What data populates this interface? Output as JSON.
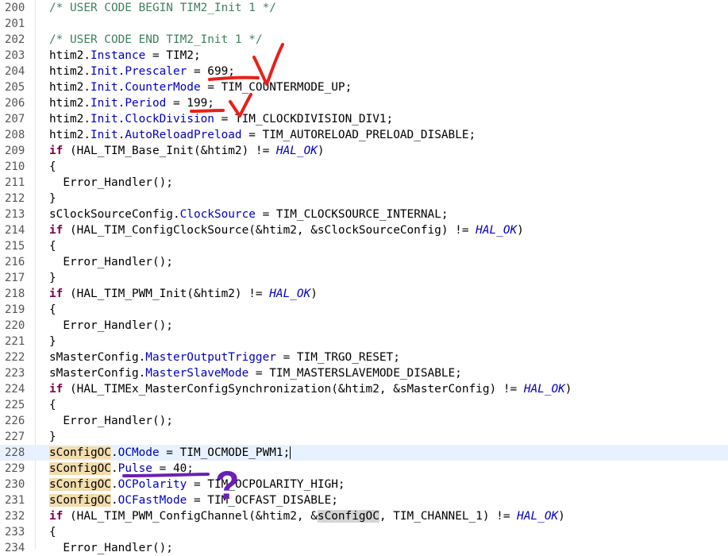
{
  "editor": {
    "lines": [
      {
        "n": "200",
        "seg": [
          [
            "/* USER CODE BEGIN TIM2_Init 1 */",
            "cm"
          ]
        ]
      },
      {
        "n": "201",
        "seg": []
      },
      {
        "n": "202",
        "seg": [
          [
            "/* USER CODE END TIM2_Init 1 */",
            "cm"
          ]
        ]
      },
      {
        "n": "203",
        "seg": [
          [
            "htim2.",
            ""
          ],
          [
            "Instance",
            "fld"
          ],
          [
            " = TIM2;",
            ""
          ]
        ]
      },
      {
        "n": "204",
        "seg": [
          [
            "htim2.",
            ""
          ],
          [
            "Init",
            "fld"
          ],
          [
            ".",
            ""
          ],
          [
            "Prescaler",
            "fld"
          ],
          [
            " = 699;",
            ""
          ]
        ]
      },
      {
        "n": "205",
        "seg": [
          [
            "htim2.",
            ""
          ],
          [
            "Init",
            "fld"
          ],
          [
            ".",
            ""
          ],
          [
            "CounterMode",
            "fld"
          ],
          [
            " = TIM_COUNTERMODE_UP;",
            ""
          ]
        ]
      },
      {
        "n": "206",
        "seg": [
          [
            "htim2.",
            ""
          ],
          [
            "Init",
            "fld"
          ],
          [
            ".",
            ""
          ],
          [
            "Period",
            "fld"
          ],
          [
            " = 199;",
            ""
          ]
        ]
      },
      {
        "n": "207",
        "seg": [
          [
            "htim2.",
            ""
          ],
          [
            "Init",
            "fld"
          ],
          [
            ".",
            ""
          ],
          [
            "ClockDivision",
            "fld"
          ],
          [
            " = TIM_CLOCKDIVISION_DIV1;",
            ""
          ]
        ]
      },
      {
        "n": "208",
        "seg": [
          [
            "htim2.",
            ""
          ],
          [
            "Init",
            "fld"
          ],
          [
            ".",
            ""
          ],
          [
            "AutoReloadPreload",
            "fld"
          ],
          [
            " = TIM_AUTORELOAD_PRELOAD_DISABLE;",
            ""
          ]
        ]
      },
      {
        "n": "209",
        "seg": [
          [
            "if",
            "kw"
          ],
          [
            " (HAL_TIM_Base_Init(&htim2) != ",
            ""
          ],
          [
            "HAL_OK",
            "hl"
          ],
          [
            ")",
            ""
          ]
        ]
      },
      {
        "n": "210",
        "seg": [
          [
            "{",
            ""
          ]
        ]
      },
      {
        "n": "211",
        "seg": [
          [
            "  Error_Handler();",
            ""
          ]
        ]
      },
      {
        "n": "212",
        "seg": [
          [
            "}",
            ""
          ]
        ]
      },
      {
        "n": "213",
        "seg": [
          [
            "sClockSourceConfig.",
            ""
          ],
          [
            "ClockSource",
            "fld"
          ],
          [
            " = TIM_CLOCKSOURCE_INTERNAL;",
            ""
          ]
        ]
      },
      {
        "n": "214",
        "seg": [
          [
            "if",
            "kw"
          ],
          [
            " (HAL_TIM_ConfigClockSource(&htim2, &sClockSourceConfig) != ",
            ""
          ],
          [
            "HAL_OK",
            "hl"
          ],
          [
            ")",
            ""
          ]
        ]
      },
      {
        "n": "215",
        "seg": [
          [
            "{",
            ""
          ]
        ]
      },
      {
        "n": "216",
        "seg": [
          [
            "  Error_Handler();",
            ""
          ]
        ]
      },
      {
        "n": "217",
        "seg": [
          [
            "}",
            ""
          ]
        ]
      },
      {
        "n": "218",
        "seg": [
          [
            "if",
            "kw"
          ],
          [
            " (HAL_TIM_PWM_Init(&htim2) != ",
            ""
          ],
          [
            "HAL_OK",
            "hl"
          ],
          [
            ")",
            ""
          ]
        ]
      },
      {
        "n": "219",
        "seg": [
          [
            "{",
            ""
          ]
        ]
      },
      {
        "n": "220",
        "seg": [
          [
            "  Error_Handler();",
            ""
          ]
        ]
      },
      {
        "n": "221",
        "seg": [
          [
            "}",
            ""
          ]
        ]
      },
      {
        "n": "222",
        "seg": [
          [
            "sMasterConfig.",
            ""
          ],
          [
            "MasterOutputTrigger",
            "fld"
          ],
          [
            " = TIM_TRGO_RESET;",
            ""
          ]
        ]
      },
      {
        "n": "223",
        "seg": [
          [
            "sMasterConfig.",
            ""
          ],
          [
            "MasterSlaveMode",
            "fld"
          ],
          [
            " = TIM_MASTERSLAVEMODE_DISABLE;",
            ""
          ]
        ]
      },
      {
        "n": "224",
        "seg": [
          [
            "if",
            "kw"
          ],
          [
            " (HAL_TIMEx_MasterConfigSynchronization(&htim2, &sMasterConfig) != ",
            ""
          ],
          [
            "HAL_OK",
            "hl"
          ],
          [
            ")",
            ""
          ]
        ]
      },
      {
        "n": "225",
        "seg": [
          [
            "{",
            ""
          ]
        ]
      },
      {
        "n": "226",
        "seg": [
          [
            "  Error_Handler();",
            ""
          ]
        ]
      },
      {
        "n": "227",
        "seg": [
          [
            "}",
            ""
          ]
        ]
      },
      {
        "n": "228",
        "current": true,
        "seg": [
          [
            "sConfigOC",
            "occ"
          ],
          [
            ".",
            ""
          ],
          [
            "OCMode",
            "fld"
          ],
          [
            " = TIM_OCMODE_PWM1;",
            ""
          ],
          [
            "|",
            "caret"
          ]
        ]
      },
      {
        "n": "229",
        "seg": [
          [
            "sConfigOC",
            "occ"
          ],
          [
            ".",
            ""
          ],
          [
            "Pulse",
            "fld"
          ],
          [
            " = 40;",
            ""
          ]
        ]
      },
      {
        "n": "230",
        "seg": [
          [
            "sConfigOC",
            "occ"
          ],
          [
            ".",
            ""
          ],
          [
            "OCPolarity",
            "fld"
          ],
          [
            " = TIM_OCPOLARITY_HIGH;",
            ""
          ]
        ]
      },
      {
        "n": "231",
        "seg": [
          [
            "sConfigOC",
            "occ"
          ],
          [
            ".",
            ""
          ],
          [
            "OCFastMode",
            "fld"
          ],
          [
            " = TIM_OCFAST_DISABLE;",
            ""
          ]
        ]
      },
      {
        "n": "232",
        "seg": [
          [
            "if",
            "kw"
          ],
          [
            " (HAL_TIM_PWM_ConfigChannel(&htim2, &",
            ""
          ],
          [
            "sConfigOC",
            "occ2"
          ],
          [
            ", TIM_CHANNEL_1) != ",
            ""
          ],
          [
            "HAL_OK",
            "hl"
          ],
          [
            ")",
            ""
          ]
        ]
      },
      {
        "n": "233",
        "seg": [
          [
            "{",
            ""
          ]
        ]
      },
      {
        "n": "234",
        "seg": [
          [
            "  Error_Handler();",
            ""
          ]
        ]
      }
    ]
  },
  "colors": {
    "annotation_red": "#e8201a",
    "annotation_purple": "#6a1fb5",
    "comment": "#3f7f5f",
    "field": "#0000c0",
    "keyword": "#7f0055"
  },
  "annotations": {
    "question_mark": "?"
  }
}
